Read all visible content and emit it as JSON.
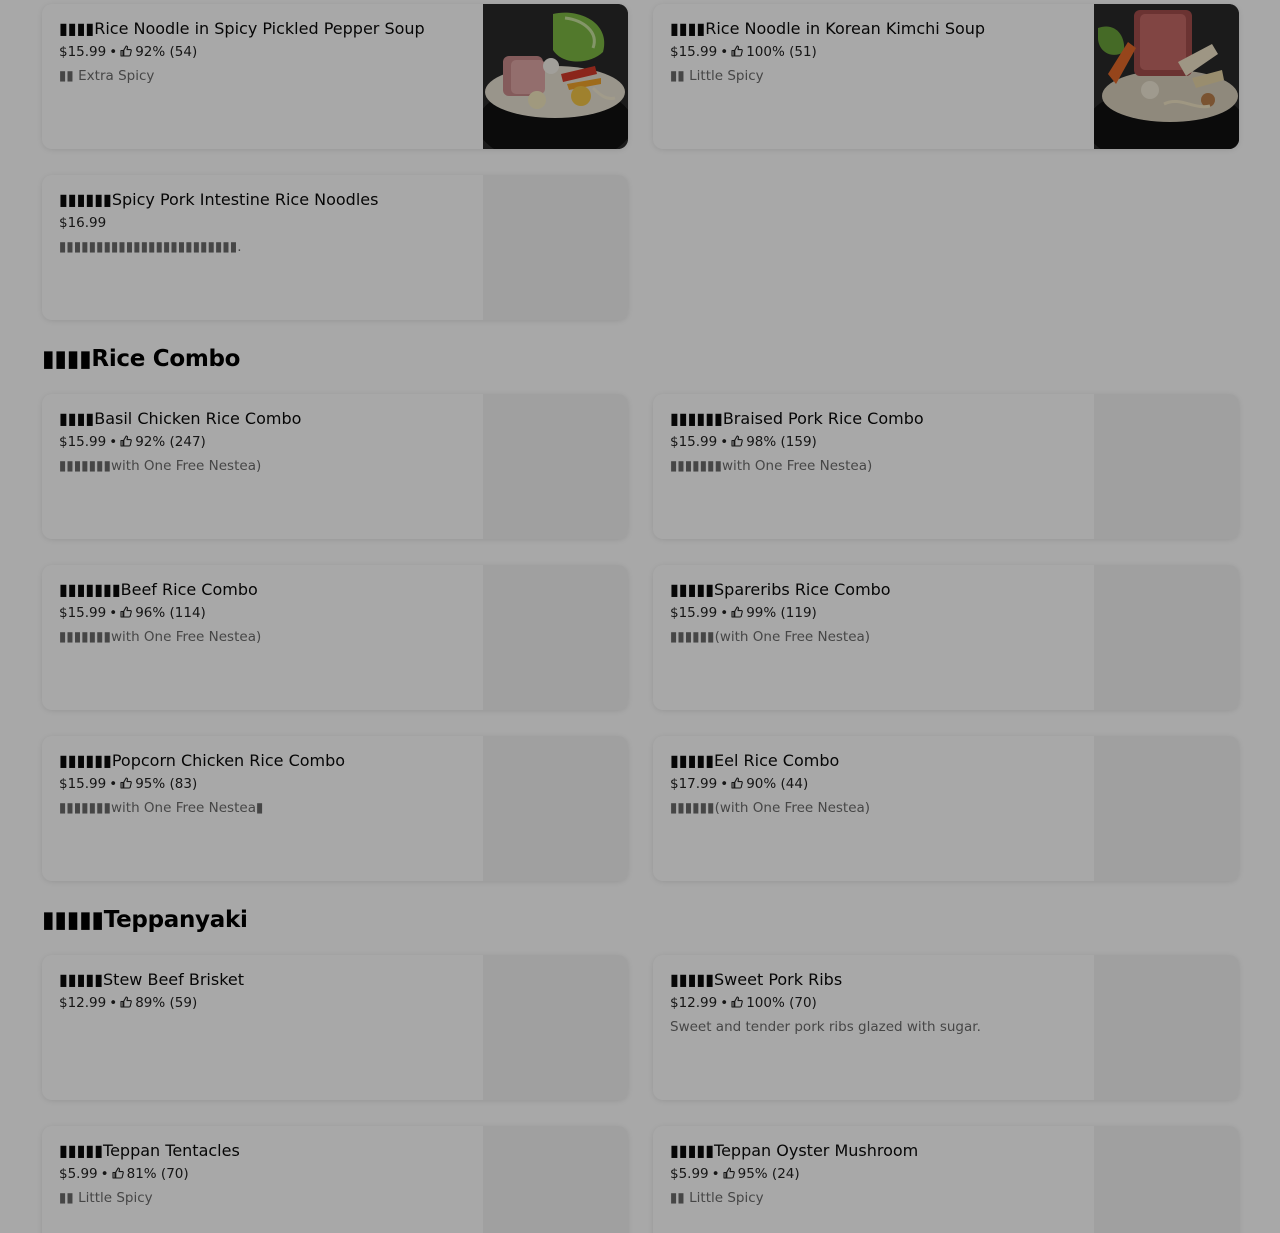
{
  "sections": [
    {
      "id": "rice-combo",
      "title": "▮▮▮▮Rice Combo"
    },
    {
      "id": "teppanyaki",
      "title": "▮▮▮▮▮Teppanyaki"
    }
  ],
  "items": [
    {
      "name": "▮▮▮▮Rice Noodle in Spicy Pickled Pepper Soup",
      "price": "$15.99",
      "rating": "92% (54)",
      "description": "▮▮ Extra Spicy"
    },
    {
      "name": "▮▮▮▮Rice Noodle in Korean Kimchi Soup",
      "price": "$15.99",
      "rating": "100% (51)",
      "description": "▮▮ Little Spicy"
    },
    {
      "name": "▮▮▮▮▮▮Spicy Pork Intestine Rice Noodles",
      "price": "$16.99",
      "rating": "",
      "description": "▮▮▮▮▮▮▮▮▮▮▮▮▮▮▮▮▮▮▮▮▮▮▮▮."
    },
    {
      "name": "▮▮▮▮Basil Chicken Rice Combo",
      "price": "$15.99",
      "rating": "92% (247)",
      "description": "▮▮▮▮▮▮▮with One Free Nestea)"
    },
    {
      "name": "▮▮▮▮▮▮Braised Pork Rice Combo",
      "price": "$15.99",
      "rating": "98% (159)",
      "description": "▮▮▮▮▮▮▮with One Free Nestea)"
    },
    {
      "name": "▮▮▮▮▮▮▮Beef Rice Combo",
      "price": "$15.99",
      "rating": "96% (114)",
      "description": "▮▮▮▮▮▮▮with One Free Nestea)"
    },
    {
      "name": "▮▮▮▮▮Spareribs Rice Combo",
      "price": "$15.99",
      "rating": "99% (119)",
      "description": "▮▮▮▮▮▮(with One Free Nestea)"
    },
    {
      "name": "▮▮▮▮▮▮Popcorn Chicken Rice Combo",
      "price": "$15.99",
      "rating": "95% (83)",
      "description": "▮▮▮▮▮▮▮with One Free Nestea▮"
    },
    {
      "name": "▮▮▮▮▮Eel Rice Combo",
      "price": "$17.99",
      "rating": "90% (44)",
      "description": "▮▮▮▮▮▮(with One Free Nestea)"
    },
    {
      "name": "▮▮▮▮▮Stew Beef Brisket",
      "price": "$12.99",
      "rating": "89% (59)",
      "description": ""
    },
    {
      "name": "▮▮▮▮▮Sweet Pork Ribs",
      "price": "$12.99",
      "rating": "100% (70)",
      "description": "Sweet and tender pork ribs glazed with sugar."
    },
    {
      "name": "▮▮▮▮▮Teppan Tentacles",
      "price": "$5.99",
      "rating": "81% (70)",
      "description": "▮▮ Little Spicy"
    },
    {
      "name": "▮▮▮▮▮Teppan Oyster Mushroom",
      "price": "$5.99",
      "rating": "95% (24)",
      "description": "▮▮ Little Spicy"
    }
  ],
  "meta_separator": "•",
  "icons": {
    "rating": "thumbs-up-icon"
  },
  "colors": {
    "overlay": "#000000",
    "card_background": "#ffffff",
    "page_background": "#ffffff"
  }
}
